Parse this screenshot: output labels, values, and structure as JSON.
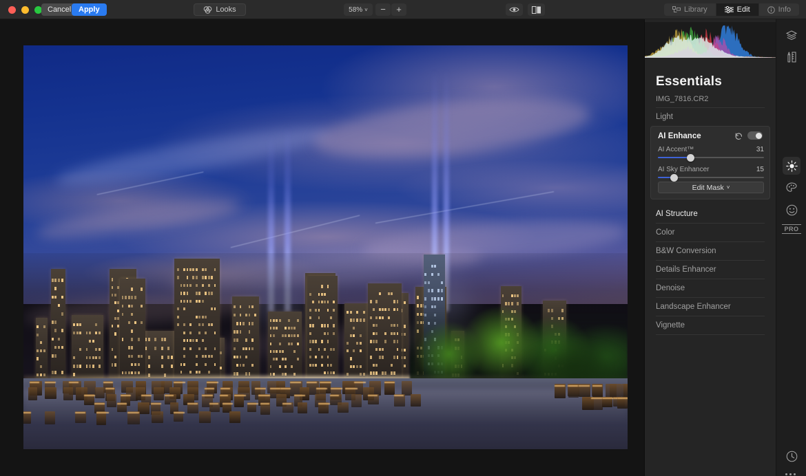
{
  "window": {
    "traffic_lights": [
      "close",
      "minimize",
      "zoom"
    ],
    "cancel_label": "Cancel",
    "apply_label": "Apply"
  },
  "toolbar": {
    "looks_label": "Looks",
    "looks_icon": "looks-icon",
    "zoom_value": "58%",
    "zoom_chevron": "˅",
    "zoom_out_label": "−",
    "zoom_in_label": "+",
    "preview_icon": "eye-icon",
    "compare_icon": "before-after-icon"
  },
  "modes": {
    "tabs": [
      {
        "label": "Library",
        "icon": "library-icon",
        "active": false
      },
      {
        "label": "Edit",
        "icon": "sliders-icon",
        "active": true
      },
      {
        "label": "Info",
        "icon": "info-icon",
        "active": false
      }
    ]
  },
  "panel": {
    "histogram_name": "rgb-histogram",
    "title": "Essentials",
    "filename": "IMG_7816.CR2",
    "tools_above": [
      {
        "label": "Light",
        "bright": false
      }
    ],
    "ai_enhance": {
      "title": "AI Enhance",
      "reset_icon": "reset-arrow-icon",
      "toggle_icon": "visibility-toggle",
      "toggle_on": true,
      "sliders": [
        {
          "name": "AI Accent™",
          "value": "31",
          "percent": 31
        },
        {
          "name": "AI Sky Enhancer",
          "value": "15",
          "percent": 15
        }
      ],
      "mask_button": "Edit Mask",
      "mask_chevron": "˅"
    },
    "tools_below": [
      {
        "label": "AI Structure",
        "bright": true
      },
      {
        "label": "Color",
        "bright": false
      },
      {
        "label": "B&W Conversion",
        "bright": false
      },
      {
        "label": "Details Enhancer",
        "bright": false
      },
      {
        "label": "Denoise",
        "bright": false
      },
      {
        "label": "Landscape Enhancer",
        "bright": false
      },
      {
        "label": "Vignette",
        "bright": false
      }
    ]
  },
  "rail": {
    "items": [
      {
        "icon": "layers-icon",
        "selected": false
      },
      {
        "icon": "tools-icon",
        "selected": false
      },
      {
        "icon": "essentials-sun-icon",
        "selected": true
      },
      {
        "icon": "creative-palette-icon",
        "selected": false
      },
      {
        "icon": "portrait-face-icon",
        "selected": false
      }
    ],
    "pro_label": "PRO",
    "history_icon": "history-clock-icon",
    "more_icon": "more-dots-icon"
  },
  "colors": {
    "accent_blue": "#2a7bf0",
    "slider_fill": "#3f63d6",
    "panel_bg": "#252525",
    "canvas_bg": "#141414",
    "titlebar_bg": "#2b2b2b"
  },
  "photo": {
    "subject": "Lower Manhattan skyline at dusk with Tribute in Light beams",
    "alt": "New York City night skyline over water with pier pilings"
  }
}
